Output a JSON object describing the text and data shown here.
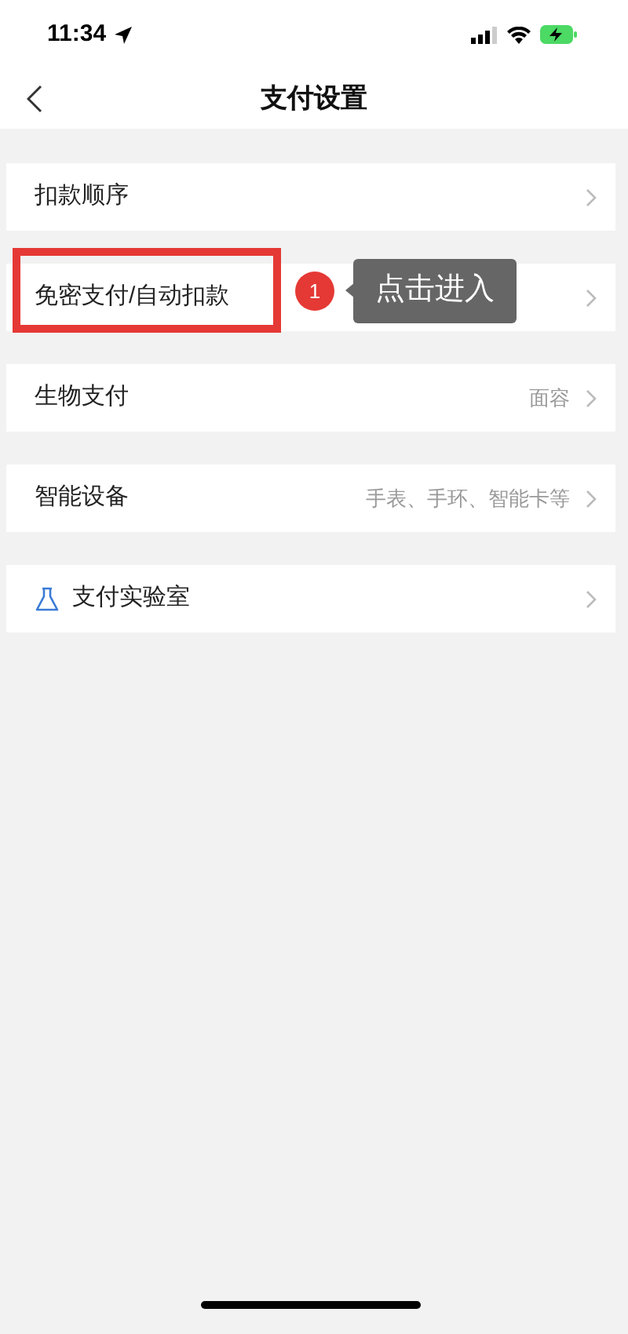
{
  "status_bar": {
    "time": "11:34"
  },
  "nav": {
    "title": "支付设置"
  },
  "rows": [
    {
      "kind": "plain",
      "label": "扣款顺序",
      "highlighted": false
    },
    {
      "kind": "plain",
      "label": "免密支付/自动扣款",
      "highlighted": true,
      "callout": {
        "number": "1",
        "text": "点击进入"
      }
    },
    {
      "kind": "plain",
      "label": "生物支付",
      "value": "面容",
      "highlighted": false
    },
    {
      "kind": "plain",
      "label": "智能设备",
      "value": "手表、手环、智能卡等",
      "highlighted": false
    },
    {
      "kind": "icon",
      "label": "支付实验室",
      "highlighted": false
    }
  ]
}
